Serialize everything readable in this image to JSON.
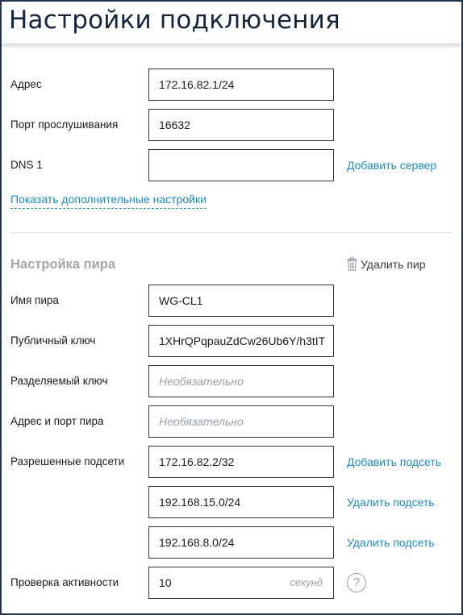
{
  "header": {
    "title": "Настройки подключения"
  },
  "connection": {
    "address": {
      "label": "Адрес",
      "value": "172.16.82.1/24"
    },
    "listen_port": {
      "label": "Порт прослушивания",
      "value": "16632"
    },
    "dns1": {
      "label": "DNS 1",
      "value": "",
      "action": "Добавить сервер"
    },
    "advanced_link": "Показать дополнительные настройки"
  },
  "peer": {
    "section_title": "Настройка пира",
    "remove_label": "Удалить пир",
    "name": {
      "label": "Имя пира",
      "value": "WG-CL1"
    },
    "public_key": {
      "label": "Публичный ключ",
      "value": "1XHrQPqpauZdCw26Ub6Y/h3tIT"
    },
    "preshared_key": {
      "label": "Разделяемый ключ",
      "value": "",
      "placeholder": "Необязательно"
    },
    "endpoint": {
      "label": "Адрес и порт пира",
      "value": "",
      "placeholder": "Необязательно"
    },
    "allowed_ips": {
      "label": "Разрешенные подсети",
      "items": [
        {
          "value": "172.16.82.2/32",
          "action": "Добавить подсеть"
        },
        {
          "value": "192.168.15.0/24",
          "action": "Удалить подсеть"
        },
        {
          "value": "192.168.8.0/24",
          "action": "Удалить подсеть"
        }
      ]
    },
    "keepalive": {
      "label": "Проверка активности",
      "value": "10",
      "unit": "секунд",
      "help": "?"
    }
  }
}
